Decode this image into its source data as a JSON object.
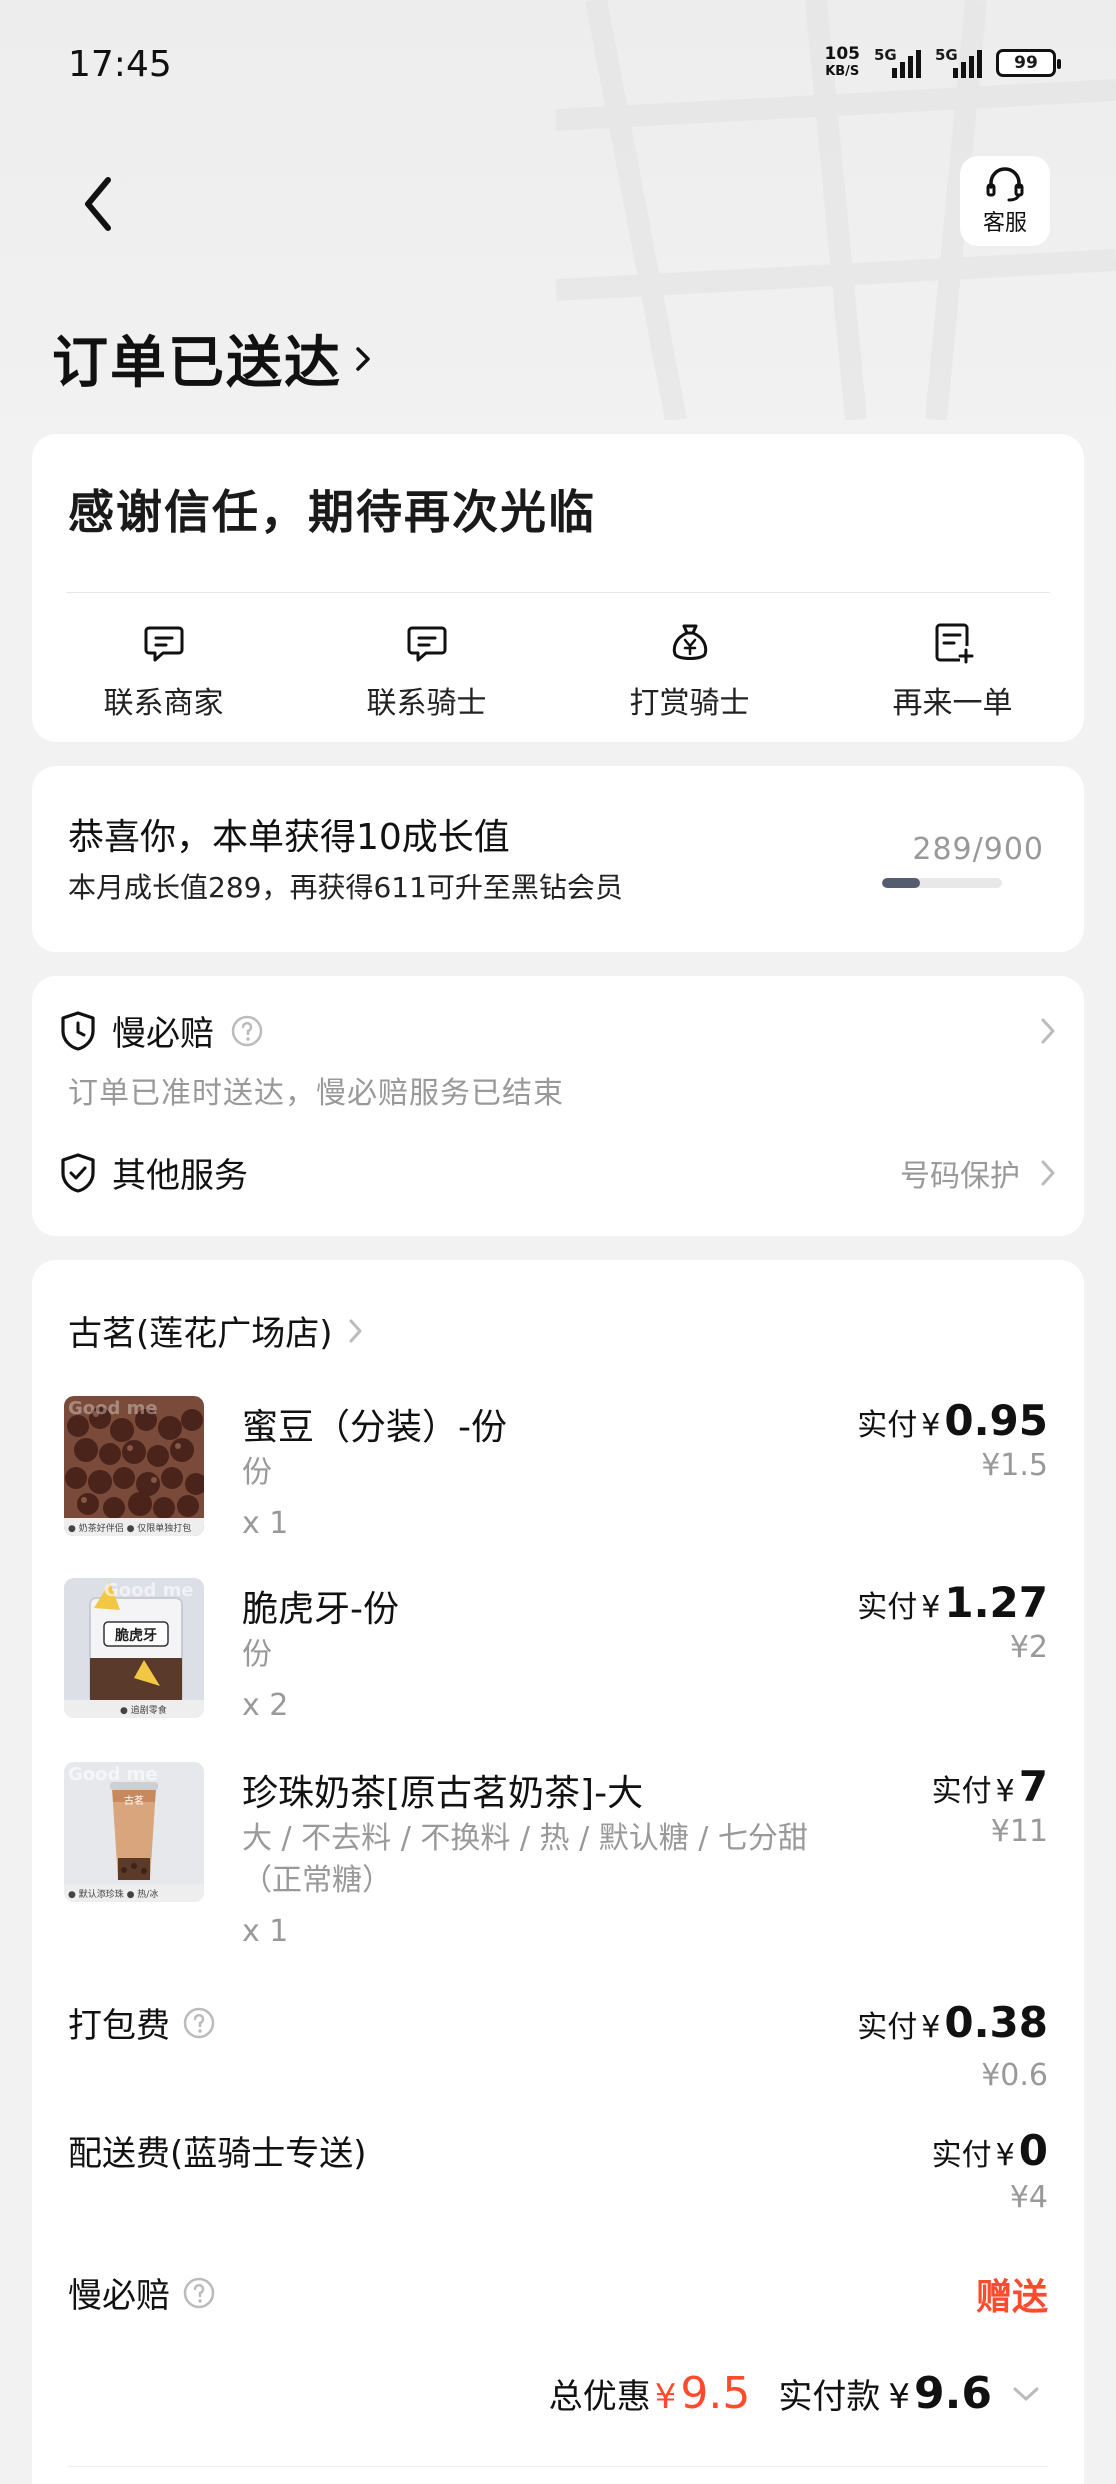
{
  "status_bar": {
    "time": "17:45",
    "net_speed_value": "105",
    "net_speed_unit": "KB/S",
    "signal1_label": "5G",
    "signal2_label": "5G",
    "battery": "99"
  },
  "header": {
    "service_label": "客服",
    "order_status": "订单已送达"
  },
  "thanks_card": {
    "headline": "感谢信任，期待再次光临",
    "actions": [
      {
        "label": "联系商家",
        "icon": "chat-icon"
      },
      {
        "label": "联系骑士",
        "icon": "chat-icon"
      },
      {
        "label": "打赏骑士",
        "icon": "money-bag-icon"
      },
      {
        "label": "再来一单",
        "icon": "reorder-icon"
      }
    ]
  },
  "growth_card": {
    "title": "恭喜你，本单获得10成长值",
    "subtitle": "本月成长值289，再获得611可升至黑钻会员",
    "progress_text": "289/900",
    "progress_fraction": 0.32
  },
  "service_card": {
    "slow_compensation": {
      "name": "慢必赔",
      "desc": "订单已准时送达，慢必赔服务已结束"
    },
    "other_services": {
      "name": "其他服务",
      "value": "号码保护"
    }
  },
  "order_card": {
    "shop_name": "古茗(莲花广场店)",
    "items": [
      {
        "name": "蜜豆（分装）-份",
        "spec": "份",
        "qty": "x 1",
        "paid_label": "实付",
        "currency": "¥",
        "paid": "0.95",
        "original": "¥1.5"
      },
      {
        "name": "脆虎牙-份",
        "spec": "份",
        "qty": "x 2",
        "paid_label": "实付",
        "currency": "¥",
        "paid": "1.27",
        "original": "¥2"
      },
      {
        "name": "珍珠奶茶[原古茗奶茶]-大",
        "spec": "大 / 不去料 / 不换料 / 热 / 默认糖 / 七分甜（正常糖）",
        "qty": "x 1",
        "paid_label": "实付",
        "currency": "¥",
        "paid": "7",
        "original": "¥11"
      }
    ],
    "thumb_badges": {
      "item1": "● 奶茶好伴侣  ● 仅限单独打包",
      "item2": "● 追剧零食",
      "item3": "● 默认添珍珠  ● 热/冰",
      "item2_pack": "脆虎牙",
      "watermark": "Good me",
      "cup_logo": "古茗"
    },
    "fees": {
      "packing": {
        "name": "打包费",
        "paid_label": "实付",
        "currency": "¥",
        "paid": "0.38",
        "original": "¥0.6"
      },
      "delivery": {
        "name": "配送费(蓝骑士专送)",
        "paid_label": "实付",
        "currency": "¥",
        "paid": "0",
        "original": "¥4"
      },
      "slow": {
        "name": "慢必赔",
        "value": "赠送"
      }
    },
    "total": {
      "discount_label": "总优惠",
      "discount_currency": "¥",
      "discount": "9.5",
      "paid_label": "实付款",
      "paid_currency": "¥",
      "paid": "9.6"
    }
  },
  "colors": {
    "accent_red": "#ff4a2b",
    "progress_fill": "#555d6e"
  }
}
